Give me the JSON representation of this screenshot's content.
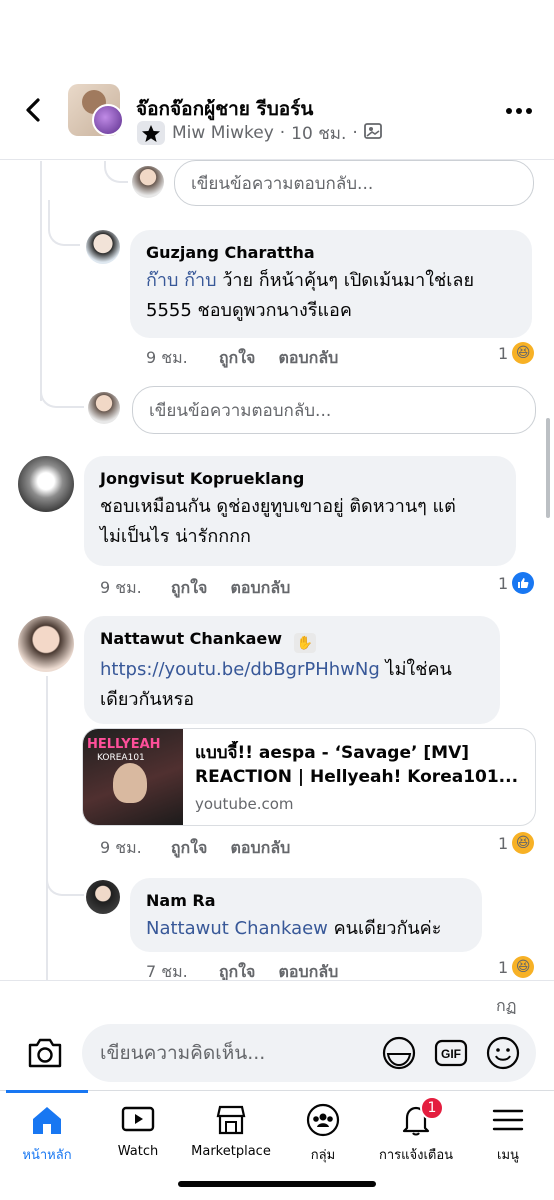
{
  "header": {
    "page_name": "จ๊อกจ๊อกผู้ชาย รีบอร์น",
    "poster_name": "Miw Miwkey",
    "time": "10 ชม.",
    "dot": "·",
    "icons": [
      "back-arrow-icon",
      "star-badge-icon",
      "album-icon",
      "more-icon"
    ]
  },
  "reply_placeholder": "เขียนข้อความตอบกลับ...",
  "labels": {
    "like": "ถูกใจ",
    "reply": "ตอบกลับ"
  },
  "comments": [
    {
      "author": "Guzjang Charattha",
      "mention": "ก๊าบ ก๊าบ",
      "text_line1": " ว้าย ก็หน้าคุ้นๆ เปิดเม้นมาใช่เลย",
      "text_line2": "5555 ชอบดูพวกนางรีแอค",
      "time": "9 ชม.",
      "reaction_count": "1",
      "reaction": "haha"
    },
    {
      "author": "Jongvisut Koprueklang",
      "text_line1": "ชอบเหมือนกัน ดูช่องยูทูบเขาอยู่ ติดหวานๆ แต่",
      "text_line2": "ไม่เป็นไร น่ารักกกก",
      "time": "9 ชม.",
      "reaction_count": "1",
      "reaction": "like"
    },
    {
      "author": "Nattawut Chankaew",
      "link": "https://youtu.be/dbBgrPHhwNg",
      "text_line1_suffix": " ไม่ใช่คน",
      "text_line2": "เดียวกันหรอ",
      "time": "9 ชม.",
      "reaction_count": "1",
      "reaction": "haha",
      "preview": {
        "title_line1": "แบบจี้!! aespa - ‘Savage’ [MV]",
        "title_line2": "REACTION | Hellyeah! Korea101...",
        "domain": "youtube.com",
        "thumb_text1": "HELLYEAH",
        "thumb_text2": "KOREA101"
      }
    },
    {
      "author": "Nam Ra",
      "mention": "Nattawut Chankaew",
      "text": " คนเดียวกันค่ะ",
      "time": "7 ชม.",
      "reaction_count": "1",
      "reaction": "haha"
    }
  ],
  "composer": {
    "typing_indicator": "กฏ",
    "placeholder": "เขียนความคิดเห็น...",
    "gif_label": "GIF"
  },
  "tabs": [
    {
      "label": "หน้าหลัก",
      "icon": "home-icon",
      "active": true
    },
    {
      "label": "Watch",
      "icon": "watch-icon"
    },
    {
      "label": "Marketplace",
      "icon": "marketplace-icon"
    },
    {
      "label": "กลุ่ม",
      "icon": "groups-icon"
    },
    {
      "label": "การแจ้งเตือน",
      "icon": "bell-icon",
      "badge": "1"
    },
    {
      "label": "เมนู",
      "icon": "menu-icon"
    }
  ],
  "colors": {
    "accent": "#1877f2",
    "link": "#385898",
    "bubble": "#f0f2f5",
    "muted": "#65676b"
  }
}
